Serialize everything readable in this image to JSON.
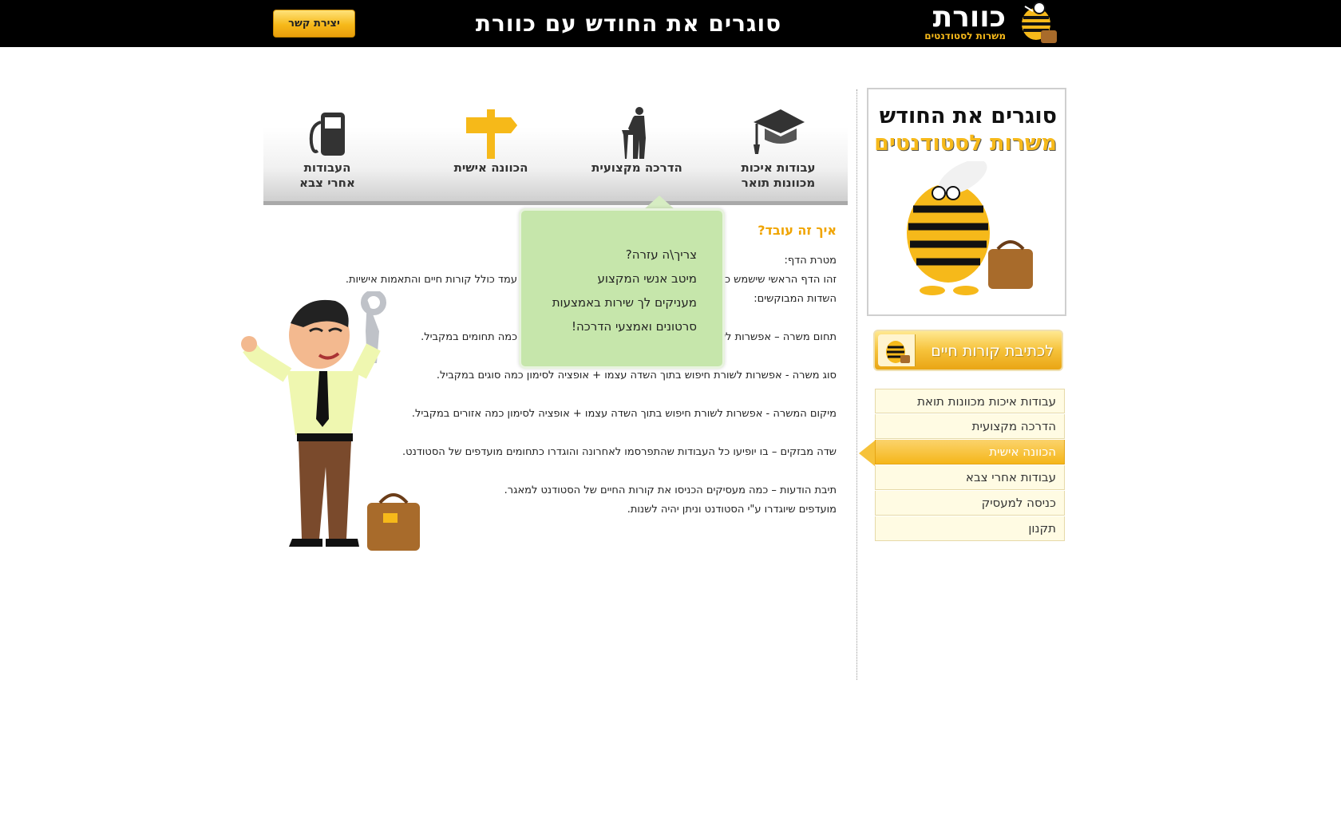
{
  "header": {
    "contact_label": "יצירת קשר",
    "slogan": "סוגרים את החודש עם כוורת",
    "logo_main": "כוורת",
    "logo_sub": "משרות לסטודנטים"
  },
  "nav": {
    "items": [
      {
        "label_line1": "עבודות איכות",
        "label_line2": "מכוונות תואר",
        "icon": "graduation-cap-icon"
      },
      {
        "label_line1": "הדרכה מקצועית",
        "label_line2": "",
        "icon": "professional-guide-icon"
      },
      {
        "label_line1": "הכוונה אישית",
        "label_line2": "",
        "icon": "signpost-icon"
      },
      {
        "label_line1": "העבודות",
        "label_line2": "אחרי צבא",
        "icon": "fuel-pump-icon"
      }
    ]
  },
  "popup": {
    "items": [
      "צריך\\ה עזרה?",
      "מיטב אנשי המקצוע",
      "מעניקים לך שירות באמצעות",
      "סרטונים ואמצעי הדרכה!"
    ]
  },
  "content": {
    "heading": "איך זה עובד?",
    "goal_label": "מטרת הדף:",
    "intro": "זהו הדף הראשי שישמש כמ",
    "intro_end": "עמד כולל קורות חיים והתאמות אישיות.",
    "fields_label": "השדות המבוקשים:",
    "field_area_start": "תחום משרה – אפשרות לש",
    "field_area_end": "כמה תחומים במקביל.",
    "field_type": "סוג משרה - אפשרות לשורת חיפוש בתוך השדה עצמו + אופציה לסימון כמה סוגים במקביל.",
    "field_location": "מיקום המשרה - אפשרות לשורת חיפוש בתוך השדה עצמו + אופציה לסימון כמה אזורים במקביל.",
    "field_featured": "שדה מבזקים – בו יופיעו כל העבודות שהתפרסמו לאחרונה והוגדרו כתחומים מועדפים של הסטודנט.",
    "field_inbox": "תיבת הודעות – כמה מעסיקים הכניסו את קורות החיים של הסטודנט למאגר.",
    "field_favorites": "מועדפים שיוגדרו ע\"י הסטודנט וניתן יהיה לשנות."
  },
  "poster": {
    "line1": "סוגרים את החודש",
    "line2": "משרות לסטודנטים"
  },
  "cv_button": {
    "label": "לכתיבת קורות חיים"
  },
  "sidebar": {
    "items": [
      {
        "label": "עבודות איכות מכוונות תואת",
        "active": false
      },
      {
        "label": "הדרכה מקצועית",
        "active": false
      },
      {
        "label": "הכוונה אישית",
        "active": true
      },
      {
        "label": "עבודות אחרי צבא",
        "active": false
      },
      {
        "label": "כניסה למעסיק",
        "active": false
      },
      {
        "label": "תקנון",
        "active": false
      }
    ]
  },
  "colors": {
    "accent": "#f6b91a",
    "popup_bg": "#c6e6ab",
    "header_bg": "#000000"
  }
}
